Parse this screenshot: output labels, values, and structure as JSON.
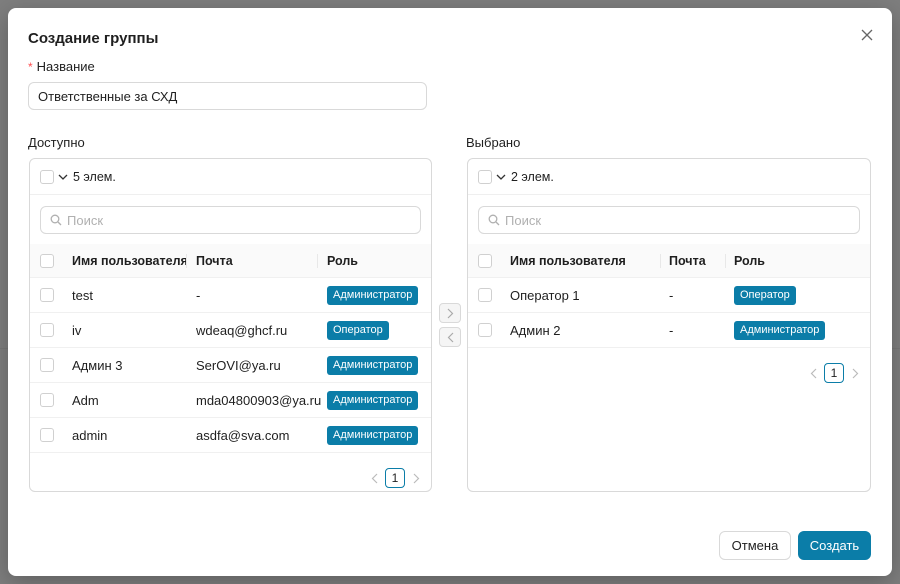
{
  "dialog": {
    "title": "Создание группы",
    "name_label": "Название",
    "name_value": "Ответственные за СХД",
    "cancel_label": "Отмена",
    "create_label": "Создать"
  },
  "available": {
    "label": "Доступно",
    "count": "5 элем.",
    "search_placeholder": "Поиск",
    "columns": [
      "Имя пользователя",
      "Почта",
      "Роль"
    ],
    "rows": [
      {
        "name": "test",
        "email": "-",
        "role": "Администратор"
      },
      {
        "name": "iv",
        "email": "wdeaq@ghcf.ru",
        "role": "Оператор"
      },
      {
        "name": "Админ 3",
        "email": "SerOVI@ya.ru",
        "role": "Администратор"
      },
      {
        "name": "Adm",
        "email": "mda04800903@ya.ru",
        "role": "Администратор"
      },
      {
        "name": "admin",
        "email": "asdfa@sva.com",
        "role": "Администратор"
      }
    ],
    "page": "1"
  },
  "selected": {
    "label": "Выбрано",
    "count": "2 элем.",
    "search_placeholder": "Поиск",
    "columns": [
      "Имя пользователя",
      "Почта",
      "Роль"
    ],
    "rows": [
      {
        "name": "Оператор 1",
        "email": "-",
        "role": "Оператор"
      },
      {
        "name": "Админ 2",
        "email": "-",
        "role": "Администратор"
      }
    ],
    "page": "1"
  },
  "colors": {
    "accent": "#0b7da8",
    "required": "#ff4d4f"
  }
}
